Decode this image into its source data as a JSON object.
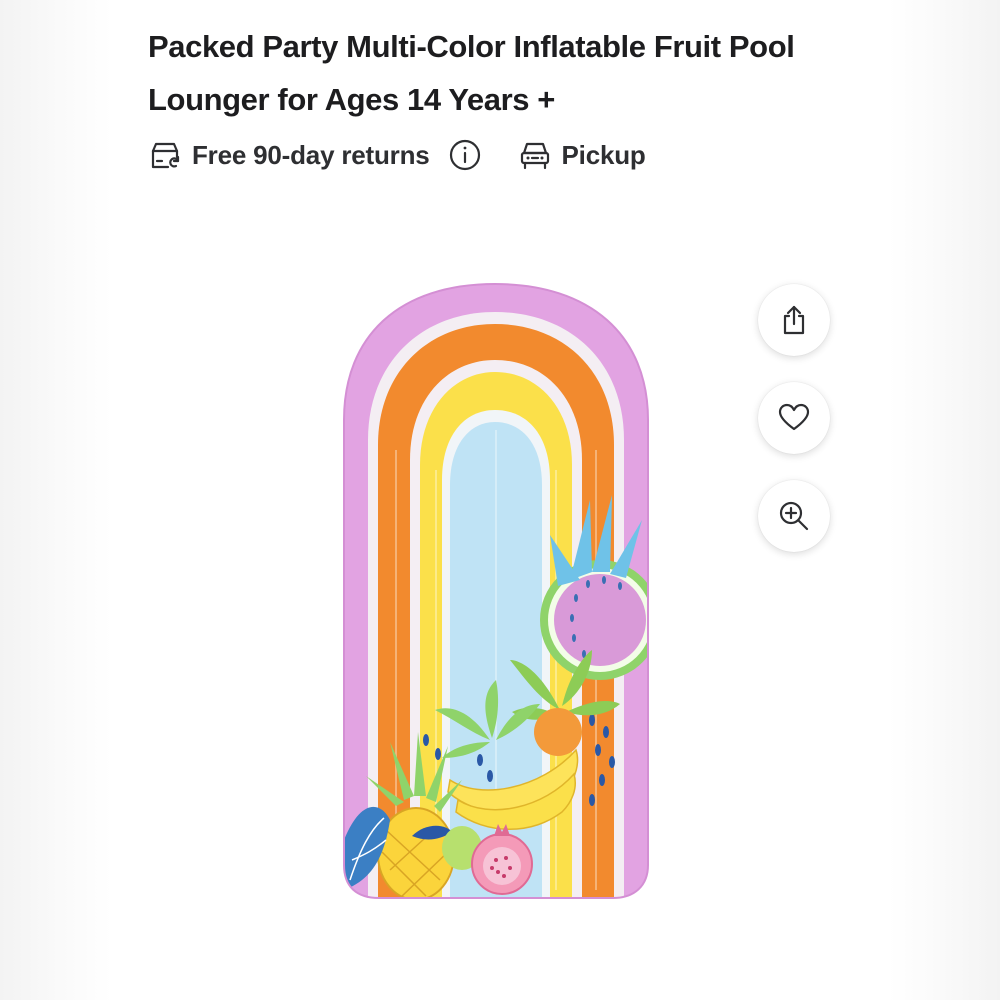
{
  "product": {
    "title": "Packed Party Multi-Color Inflatable Fruit Pool Lounger for Ages 14 Years +",
    "image_alt": "Packed Party Multi-Color Inflatable Fruit Pool Lounger"
  },
  "features": {
    "returns_label": "Free 90-day returns",
    "returns_icon": "box-return-icon",
    "info_icon": "info-icon",
    "pickup_label": "Pickup",
    "pickup_icon": "car-icon"
  },
  "actions": {
    "share_icon": "share-icon",
    "favorite_icon": "heart-icon",
    "zoom_icon": "zoom-in-icon"
  },
  "colors": {
    "title_text": "#1d1d1f",
    "icon_stroke": "#2e2f32",
    "float_pink": "#e2a3e2",
    "float_orange": "#f28a2e",
    "float_yellow": "#fbe04a",
    "float_blue": "#bfe3f5"
  }
}
